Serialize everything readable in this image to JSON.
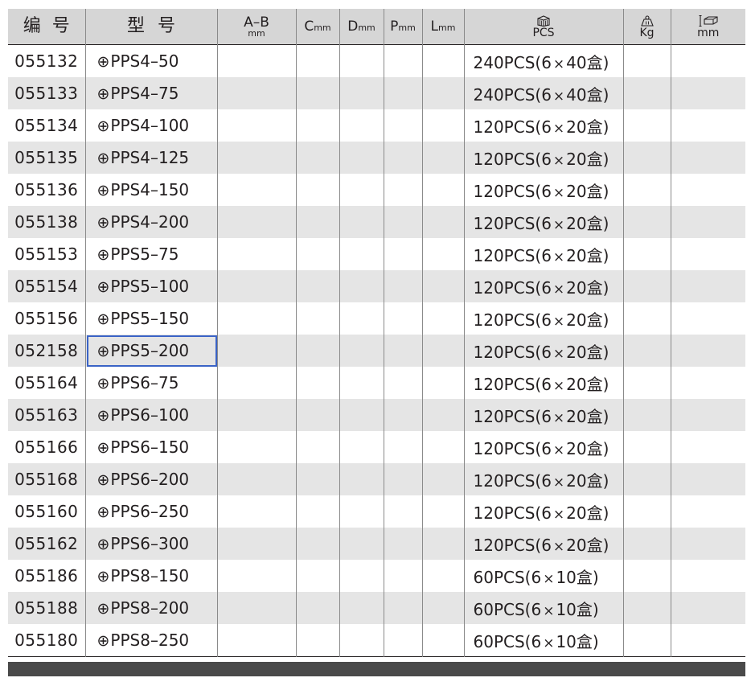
{
  "table": {
    "headers": {
      "code": "编号",
      "model": "型号",
      "ab_main": "A–B",
      "ab_unit": "mm",
      "c_letter": "C",
      "d_letter": "D",
      "p_letter": "P",
      "l_letter": "L",
      "cdpl_unit": "mm",
      "pcs_label": "PCS",
      "kg_label": "Kg",
      "size_label": "mm"
    },
    "header_icons": {
      "pcs": "box-stack-icon",
      "kg": "weight-icon",
      "size": "carton-size-icon"
    },
    "selected_row": 9,
    "rows": [
      {
        "code": "055132",
        "symbol": "⊕",
        "model": "PPS4–50",
        "pcs": "240PCS(6",
        "times": "×",
        "box": "40盒)"
      },
      {
        "code": "055133",
        "symbol": "⊕",
        "model": "PPS4–75",
        "pcs": "240PCS(6",
        "times": "×",
        "box": "40盒)"
      },
      {
        "code": "055134",
        "symbol": "⊕",
        "model": "PPS4–100",
        "pcs": "120PCS(6",
        "times": "×",
        "box": "20盒)"
      },
      {
        "code": "055135",
        "symbol": "⊕",
        "model": "PPS4–125",
        "pcs": "120PCS(6",
        "times": "×",
        "box": "20盒)"
      },
      {
        "code": "055136",
        "symbol": "⊕",
        "model": "PPS4–150",
        "pcs": "120PCS(6",
        "times": "×",
        "box": "20盒)"
      },
      {
        "code": "055138",
        "symbol": "⊕",
        "model": "PPS4–200",
        "pcs": "120PCS(6",
        "times": "×",
        "box": "20盒)"
      },
      {
        "code": "055153",
        "symbol": "⊕",
        "model": "PPS5–75",
        "pcs": "120PCS(6",
        "times": "×",
        "box": "20盒)"
      },
      {
        "code": "055154",
        "symbol": "⊕",
        "model": "PPS5–100",
        "pcs": "120PCS(6",
        "times": "×",
        "box": "20盒)"
      },
      {
        "code": "055156",
        "symbol": "⊕",
        "model": "PPS5–150",
        "pcs": "120PCS(6",
        "times": "×",
        "box": "20盒)"
      },
      {
        "code": "052158",
        "symbol": "⊕",
        "model": "PPS5–200",
        "pcs": "120PCS(6",
        "times": "×",
        "box": "20盒)"
      },
      {
        "code": "055164",
        "symbol": "⊕",
        "model": "PPS6–75",
        "pcs": "120PCS(6",
        "times": "×",
        "box": "20盒)"
      },
      {
        "code": "055163",
        "symbol": "⊕",
        "model": "PPS6–100",
        "pcs": "120PCS(6",
        "times": "×",
        "box": "20盒)"
      },
      {
        "code": "055166",
        "symbol": "⊕",
        "model": "PPS6–150",
        "pcs": "120PCS(6",
        "times": "×",
        "box": "20盒)"
      },
      {
        "code": "055168",
        "symbol": "⊕",
        "model": "PPS6–200",
        "pcs": "120PCS(6",
        "times": "×",
        "box": "20盒)"
      },
      {
        "code": "055160",
        "symbol": "⊕",
        "model": "PPS6–250",
        "pcs": "120PCS(6",
        "times": "×",
        "box": "20盒)"
      },
      {
        "code": "055162",
        "symbol": "⊕",
        "model": "PPS6–300",
        "pcs": "120PCS(6",
        "times": "×",
        "box": "20盒)"
      },
      {
        "code": "055186",
        "symbol": "⊕",
        "model": "PPS8–150",
        "pcs": "60PCS(6",
        "times": "×",
        "box": "10盒)"
      },
      {
        "code": "055188",
        "symbol": "⊕",
        "model": "PPS8–200",
        "pcs": "60PCS(6",
        "times": "×",
        "box": "10盒)"
      },
      {
        "code": "055180",
        "symbol": "⊕",
        "model": "PPS8–250",
        "pcs": "60PCS(6",
        "times": "×",
        "box": "10盒)"
      }
    ]
  },
  "colors": {
    "header_bg": "#d6d6d6",
    "stripe_bg": "#e5e5e5",
    "selection_border": "#3a63c6",
    "footer_bar": "#4a4a4a",
    "text": "#231f20"
  }
}
